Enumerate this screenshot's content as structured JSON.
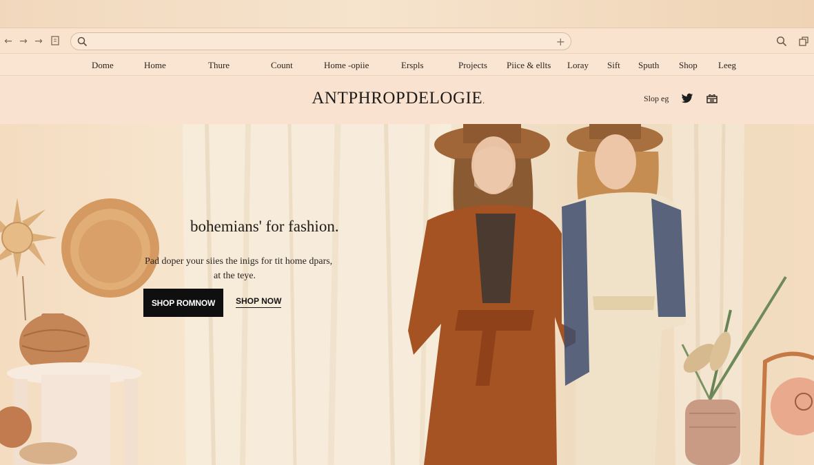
{
  "browser": {
    "back_icon": "back-arrow-icon",
    "forward_icon": "forward-arrow-icon",
    "reload_icon": "forward-arrow-icon",
    "page_icon": "page-icon",
    "url_value": "",
    "url_search_icon": "search-icon",
    "url_plus_icon": "plus-icon",
    "right_icons": [
      "search-icon",
      "window-icon"
    ]
  },
  "nav": {
    "items": [
      "Dome",
      "Home",
      "Thure",
      "Count",
      "Home -opiie",
      "Erspls",
      "Projects",
      "Piice & ellts",
      "Loray",
      "Sift",
      "Sputh",
      "Shop",
      "Leeg"
    ]
  },
  "header": {
    "brand": "ANTPHROPDELOGIE",
    "brand_mark": ".",
    "shop_label": "Slop eg",
    "icons": [
      "twitter-icon",
      "gift-icon"
    ]
  },
  "hero": {
    "title": "bohemians' for fashion.",
    "subtitle_line1": "Pad doper your siies the inigs for tit home dpars,",
    "subtitle_line2": "at the teye.",
    "primary_cta": "SHOP ROMNOW",
    "secondary_cta": "SHOP NOW"
  },
  "colors": {
    "background": "#f3ddc4",
    "chrome": "#f9e3ce",
    "accent_rust": "#a65324",
    "button_black": "#0f0f10"
  }
}
